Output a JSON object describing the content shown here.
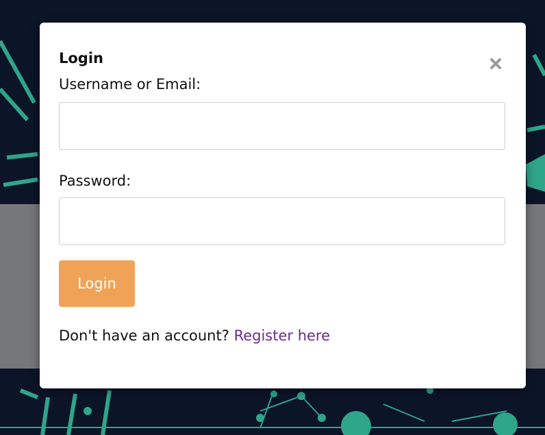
{
  "login_modal": {
    "title": "Login",
    "username_label": "Username or Email:",
    "username_value": "",
    "password_label": "Password:",
    "password_value": "",
    "login_button_label": "Login",
    "register_prompt": "Don't have an account?",
    "register_link_label": "Register here",
    "close_icon": "close-icon"
  },
  "colors": {
    "background": "#0c1428",
    "pattern_teal": "#2fa58a",
    "overlay_grey": "#808080",
    "login_button": "#f0a356",
    "register_link": "#6a2a8c"
  }
}
